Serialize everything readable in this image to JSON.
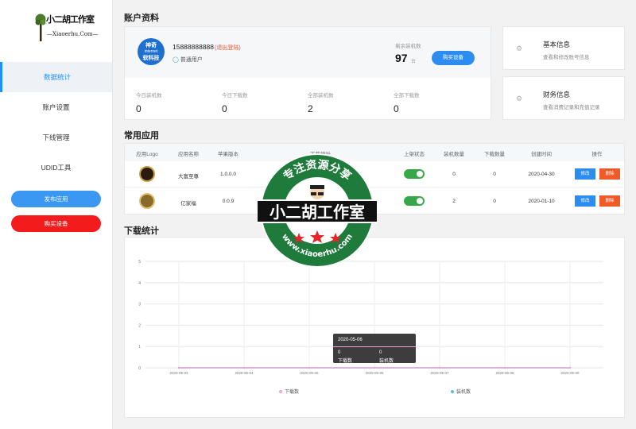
{
  "sidebar": {
    "logo_text": "小二胡工作室",
    "logo_sub": "—Xiaoerhu.Com—",
    "nav": [
      "数据统计",
      "账户设置",
      "下线管理",
      "UDID工具"
    ],
    "publish_label": "发布应用",
    "buy_label": "购买设备"
  },
  "account": {
    "title": "账户资料",
    "avatar_l1": "神奇",
    "avatar_l2": "internet",
    "avatar_l3": "软科技",
    "phone": "15888888888",
    "logout": "(退出登陆)",
    "user_type": "普通用户",
    "remain_label": "剩余装机数",
    "remain_value": "97",
    "remain_unit": "台",
    "buy_label": "购买设备",
    "stats": [
      {
        "label": "今日装机数",
        "value": "0"
      },
      {
        "label": "今日下载数",
        "value": "0"
      },
      {
        "label": "全部装机数",
        "value": "2"
      },
      {
        "label": "全部下载数",
        "value": "0"
      }
    ]
  },
  "info_cards": [
    {
      "title": "基本信息",
      "desc": "查看和修改账号信息"
    },
    {
      "title": "财务信息",
      "desc": "查看消费记录和充值记录"
    }
  ],
  "apps": {
    "title": "常用应用",
    "headers": [
      "应用Logo",
      "应用名称",
      "苹果版本",
      "下载地址",
      "上架状态",
      "装机数量",
      "下载数量",
      "创建时间",
      "操作"
    ],
    "rows": [
      {
        "name": "大富至尊",
        "version": "1.0.0.0",
        "installs": "0",
        "downloads": "0",
        "created": "2020-04-30",
        "logo_color": "#2a1a10"
      },
      {
        "name": "亿家福",
        "version": "0.0.9",
        "installs": "2",
        "downloads": "0",
        "created": "2020-01-10",
        "logo_color": "#8a6a2a"
      }
    ],
    "edit_label": "修改",
    "delete_label": "删除"
  },
  "downloads": {
    "title": "下载统计"
  },
  "chart_data": {
    "type": "line",
    "x": [
      "2020-05-03",
      "2020-05-04",
      "2020-05-05",
      "2020-05-06",
      "2020-05-07",
      "2020-05-08",
      "2020-05-09"
    ],
    "series": [
      {
        "name": "下载数",
        "values": [
          0,
          0,
          0,
          0,
          0,
          0,
          0
        ],
        "color": "#f0a6d6"
      },
      {
        "name": "装机数",
        "values": [
          0,
          0,
          0,
          0,
          0,
          0,
          0
        ],
        "color": "#5bc0de"
      }
    ],
    "y_ticks": [
      "0",
      "1",
      "2",
      "3",
      "4",
      "5"
    ],
    "ylim": [
      0,
      5
    ],
    "grid": true,
    "legend": "bottom",
    "tooltip": {
      "date": "2020-05-06",
      "a_val": "0",
      "a_name": "下载数",
      "b_val": "0",
      "b_name": "装机数"
    }
  },
  "watermark": {
    "top_text": "专注资源分享",
    "banner": "小二胡工作室",
    "url": "www.xiaoerhu.com"
  }
}
